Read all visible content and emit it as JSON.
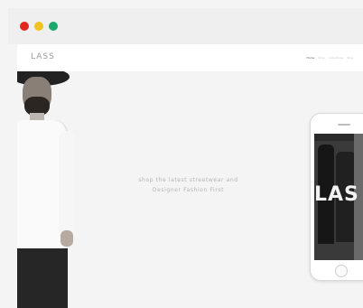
{
  "window": {
    "controls": [
      "close",
      "minimize",
      "maximize"
    ],
    "colors": {
      "close": "#e0261f",
      "minimize": "#f1c31e",
      "maximize": "#18a86b"
    }
  },
  "navbar": {
    "logo": "LASS",
    "links": [
      "Home",
      "Shop",
      "Collections",
      "Blog"
    ]
  },
  "hero": {
    "tagline": "shop the latest streetwear and\nDesigner Fashion First"
  },
  "phone_mockup": {
    "screen_text": "LAS"
  },
  "icons": [
    "hat-model-image",
    "phone-home-button"
  ]
}
